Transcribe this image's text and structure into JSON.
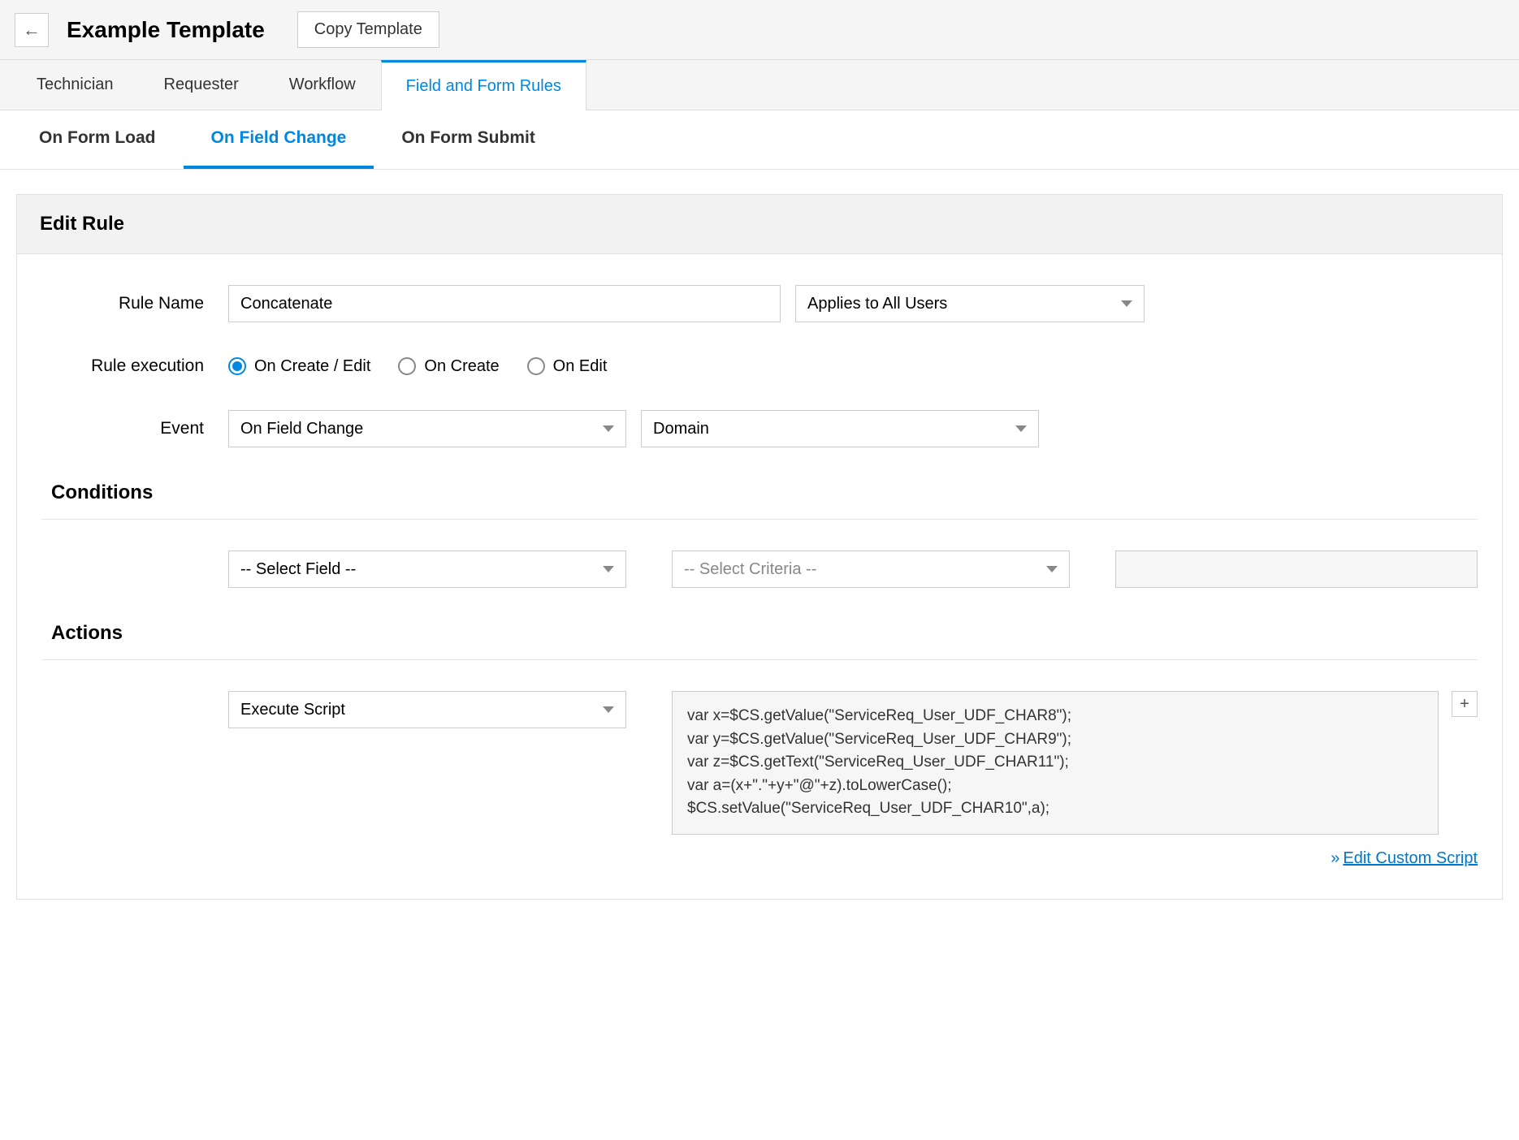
{
  "header": {
    "title": "Example Template",
    "copy_button": "Copy Template",
    "back_arrow": "←"
  },
  "tabs_primary": [
    {
      "label": "Technician",
      "active": false
    },
    {
      "label": "Requester",
      "active": false
    },
    {
      "label": "Workflow",
      "active": false
    },
    {
      "label": "Field and Form Rules",
      "active": true
    }
  ],
  "tabs_secondary": [
    {
      "label": "On Form Load",
      "active": false
    },
    {
      "label": "On Field Change",
      "active": true
    },
    {
      "label": "On Form Submit",
      "active": false
    }
  ],
  "panel": {
    "title": "Edit Rule"
  },
  "form": {
    "rule_name_label": "Rule Name",
    "rule_name_value": "Concatenate",
    "applies_to_value": "Applies to All Users",
    "rule_execution_label": "Rule execution",
    "rule_execution_options": [
      {
        "label": "On Create / Edit",
        "selected": true
      },
      {
        "label": "On Create",
        "selected": false
      },
      {
        "label": "On Edit",
        "selected": false
      }
    ],
    "event_label": "Event",
    "event_type_value": "On Field Change",
    "event_field_value": "Domain"
  },
  "conditions": {
    "title": "Conditions",
    "select_field_placeholder": "-- Select Field --",
    "select_criteria_placeholder": "-- Select Criteria --"
  },
  "actions": {
    "title": "Actions",
    "action_type_value": "Execute Script",
    "script_text": "var x=$CS.getValue(\"ServiceReq_User_UDF_CHAR8\");\nvar y=$CS.getValue(\"ServiceReq_User_UDF_CHAR9\");\nvar z=$CS.getText(\"ServiceReq_User_UDF_CHAR11\");\nvar a=(x+\".\"+y+\"@\"+z).toLowerCase();\n$CS.setValue(\"ServiceReq_User_UDF_CHAR10\",a);",
    "edit_script_link": "Edit Custom Script",
    "plus_label": "+"
  }
}
